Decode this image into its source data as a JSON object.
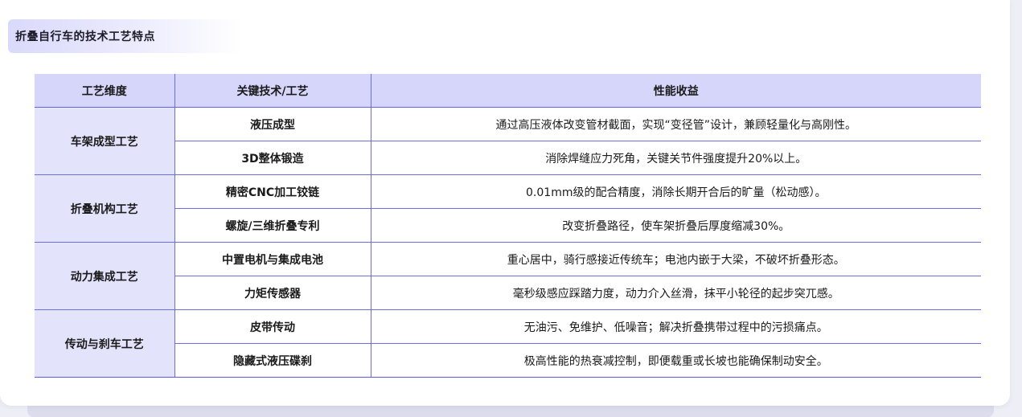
{
  "section_title": "折叠自行车的技术工艺特点",
  "table": {
    "headers": [
      "工艺维度",
      "关键技术/工艺",
      "性能收益"
    ],
    "groups": [
      {
        "name": "车架成型工艺",
        "rows": [
          {
            "tech": "液压成型",
            "benefit": "通过高压液体改变管材截面，实现“变径管”设计，兼顾轻量化与高刚性。"
          },
          {
            "tech": "3D整体锻造",
            "benefit": "消除焊缝应力死角，关键关节件强度提升20%以上。"
          }
        ]
      },
      {
        "name": "折叠机构工艺",
        "rows": [
          {
            "tech": "精密CNC加工铰链",
            "benefit": "0.01mm级的配合精度，消除长期开合后的旷量（松动感）。"
          },
          {
            "tech": "螺旋/三维折叠专利",
            "benefit": "改变折叠路径，使车架折叠后厚度缩减30%。"
          }
        ]
      },
      {
        "name": "动力集成工艺",
        "rows": [
          {
            "tech": "中置电机与集成电池",
            "benefit": "重心居中，骑行感接近传统车；电池内嵌于大梁，不破坏折叠形态。"
          },
          {
            "tech": "力矩传感器",
            "benefit": "毫秒级感应踩踏力度，动力介入丝滑，抹平小轮径的起步突兀感。"
          }
        ]
      },
      {
        "name": "传动与刹车工艺",
        "rows": [
          {
            "tech": "皮带传动",
            "benefit": "无油污、免维护、低噪音；解决折叠携带过程中的污损痛点。"
          },
          {
            "tech": "隐藏式液压碟刹",
            "benefit": "极高性能的热衰减控制，即便载重或长坡也能确保制动安全。"
          }
        ]
      }
    ]
  },
  "colors": {
    "header_bg": "#d6d6fb",
    "group_bg": "#e3e3fb",
    "border": "#6d6de0"
  }
}
